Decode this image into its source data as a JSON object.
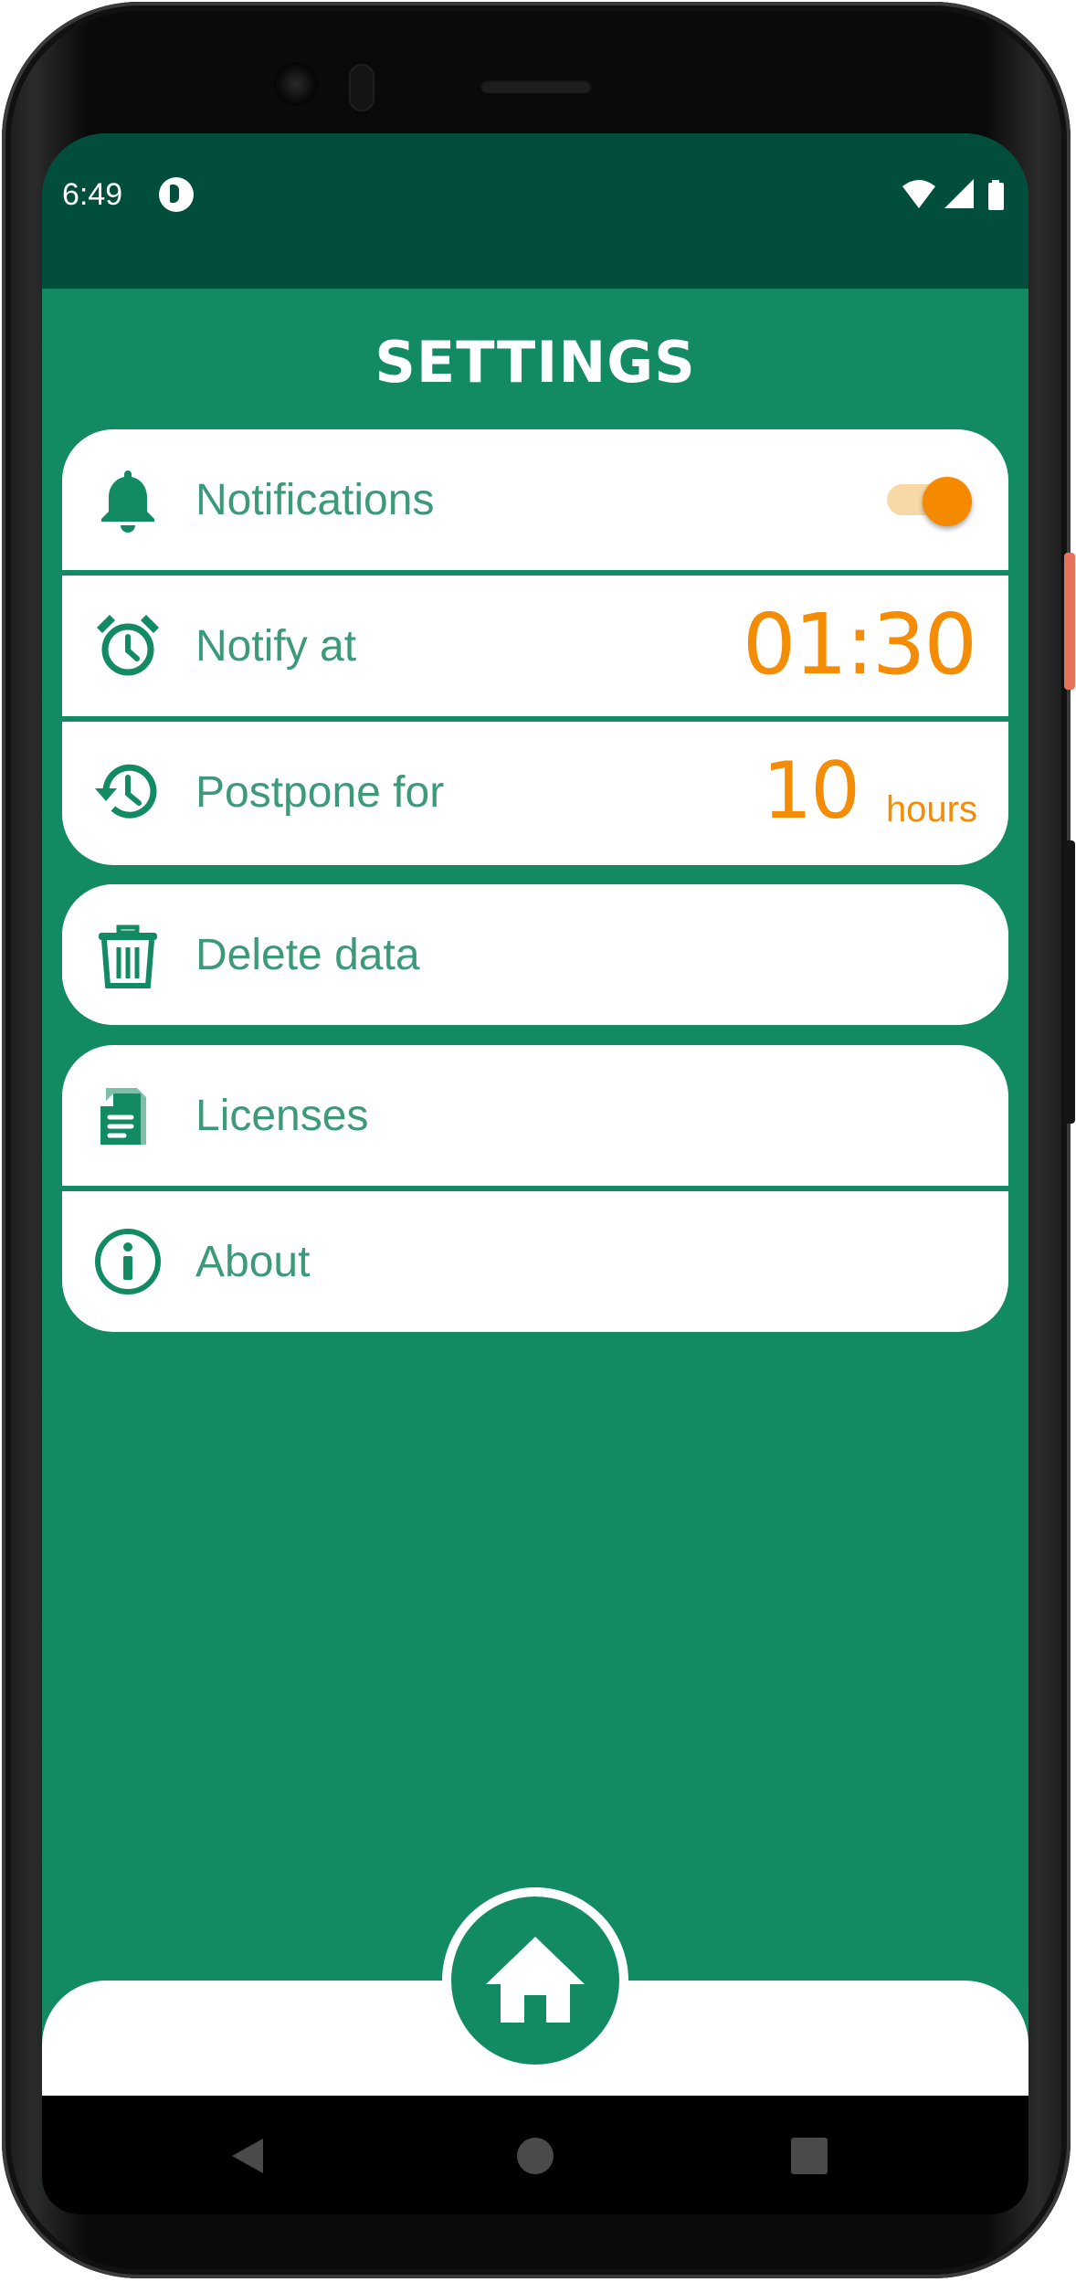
{
  "status_bar": {
    "time": "6:49"
  },
  "header": {
    "title": "SETTINGS"
  },
  "settings": {
    "notifications": {
      "label": "Notifications",
      "enabled": true
    },
    "notify_at": {
      "label": "Notify at",
      "value": "01:30"
    },
    "postpone_for": {
      "label": "Postpone for",
      "value": "10",
      "unit": "hours"
    },
    "delete_data": {
      "label": "Delete data"
    },
    "licenses": {
      "label": "Licenses"
    },
    "about": {
      "label": "About"
    }
  },
  "colors": {
    "primary": "#138b62",
    "status_bar": "#024e3d",
    "accent": "#f48c06",
    "label_text": "#3d9a78",
    "card": "#ffffff"
  },
  "icons": {
    "notifications": "bell-icon",
    "notify_at": "alarm-clock-icon",
    "postpone_for": "history-icon",
    "delete_data": "trash-icon",
    "licenses": "document-icon",
    "about": "info-icon",
    "home": "home-icon"
  }
}
